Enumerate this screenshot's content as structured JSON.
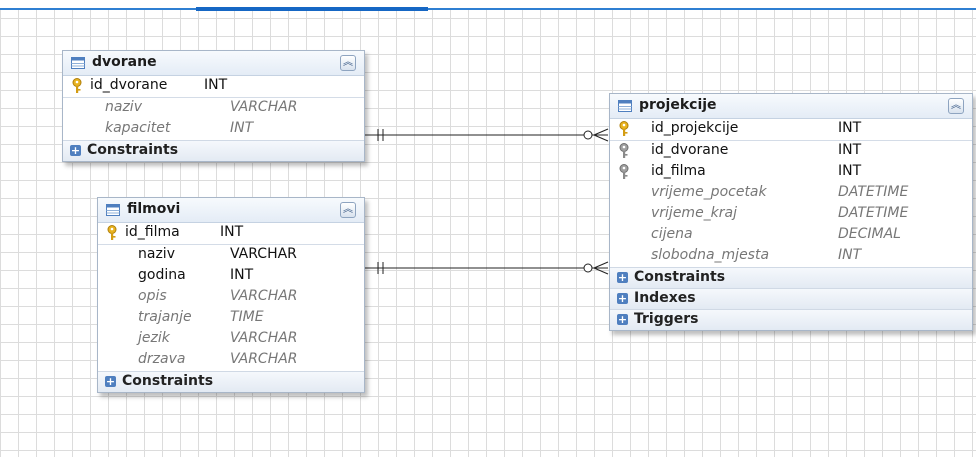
{
  "tables": {
    "dvorane": {
      "title": "dvorane",
      "pk": {
        "name": "id_dvorane",
        "type": "INT"
      },
      "columns": [
        {
          "name": "naziv",
          "type": "VARCHAR"
        },
        {
          "name": "kapacitet",
          "type": "INT"
        }
      ],
      "sections": [
        "Constraints"
      ]
    },
    "filmovi": {
      "title": "filmovi",
      "pk": {
        "name": "id_filma",
        "type": "INT"
      },
      "columns": [
        {
          "name": "naziv",
          "type": "VARCHAR"
        },
        {
          "name": "godina",
          "type": "INT"
        },
        {
          "name": "opis",
          "type": "VARCHAR"
        },
        {
          "name": "trajanje",
          "type": "TIME"
        },
        {
          "name": "jezik",
          "type": "VARCHAR"
        },
        {
          "name": "drzava",
          "type": "VARCHAR"
        }
      ],
      "sections": [
        "Constraints"
      ]
    },
    "projekcije": {
      "title": "projekcije",
      "pk": {
        "name": "id_projekcije",
        "type": "INT"
      },
      "columns": [
        {
          "name": "id_dvorane",
          "type": "INT"
        },
        {
          "name": "id_filma",
          "type": "INT"
        },
        {
          "name": "vrijeme_pocetak",
          "type": "DATETIME"
        },
        {
          "name": "vrijeme_kraj",
          "type": "DATETIME"
        },
        {
          "name": "cijena",
          "type": "DECIMAL"
        },
        {
          "name": "slobodna_mjesta",
          "type": "INT"
        }
      ],
      "sections": [
        "Constraints",
        "Indexes",
        "Triggers"
      ]
    }
  },
  "icons": {
    "table": "table-icon",
    "primary_key": "key-icon",
    "foreign_key": "foreign-key-icon",
    "collapse": "collapse-chevron-icon",
    "expand": "expand-plus-icon"
  },
  "colors": {
    "accent": "#2f7fd2",
    "key_gold": "#e8b320",
    "fk_gray": "#9a9a9a",
    "header_bg": "#e4ecf6",
    "muted_text": "#777777"
  }
}
